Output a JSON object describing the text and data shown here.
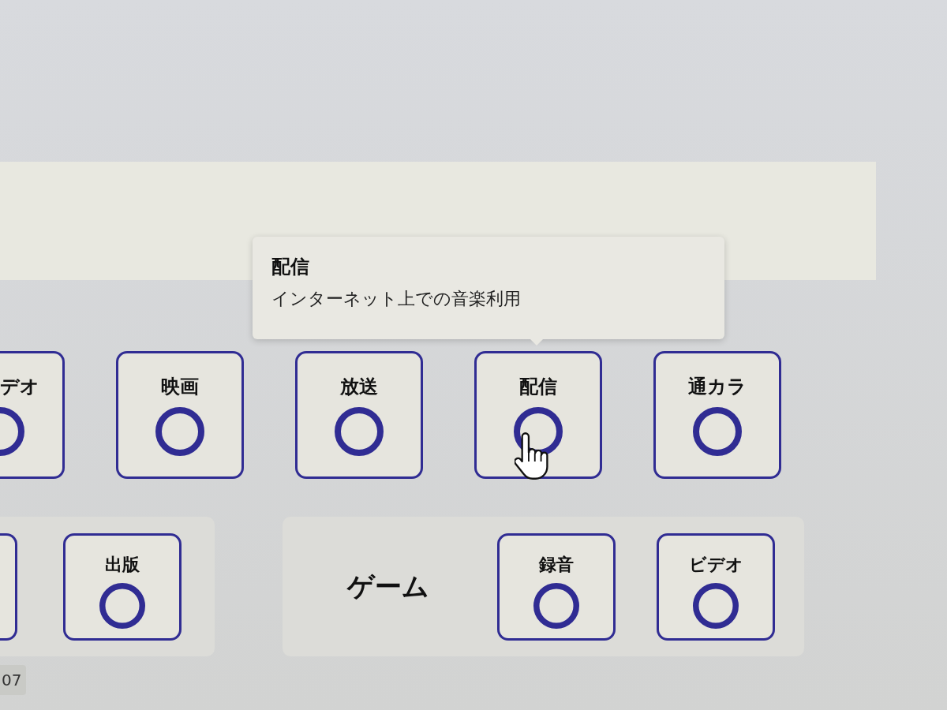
{
  "tooltip": {
    "title": "配信",
    "description": "インターネット上での音楽利用"
  },
  "row_1": {
    "tiles": [
      {
        "kind": "cut",
        "label": "デオ"
      },
      {
        "kind": "full",
        "label": "映画"
      },
      {
        "kind": "full",
        "label": "放送"
      },
      {
        "kind": "full",
        "label": "配信"
      },
      {
        "kind": "full",
        "label": "通カラ"
      }
    ]
  },
  "groups": [
    {
      "tiles": [
        {
          "kind": "cut"
        },
        {
          "kind": "full",
          "label": "出版"
        }
      ]
    },
    {
      "title": "ゲーム",
      "tiles": [
        {
          "kind": "full",
          "label": "録音"
        },
        {
          "kind": "full",
          "label": "ビデオ"
        }
      ]
    }
  ],
  "corner_tag": {
    "text": "07"
  }
}
